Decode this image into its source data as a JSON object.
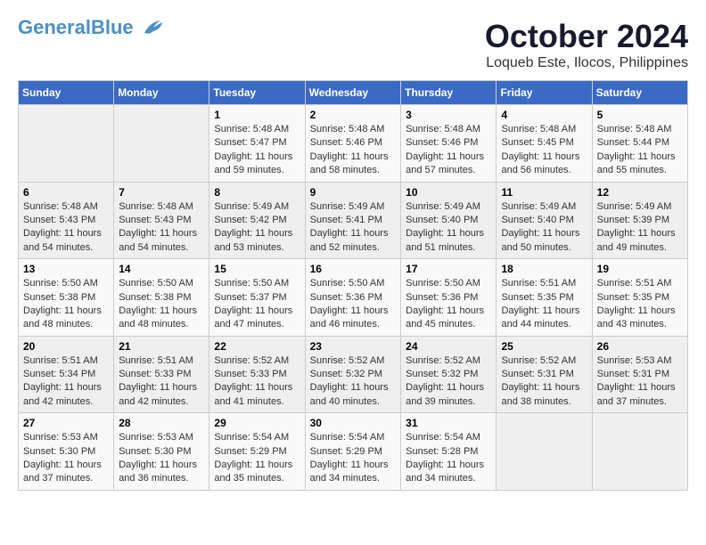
{
  "header": {
    "logo_line1": "General",
    "logo_line2": "Blue",
    "month_title": "October 2024",
    "subtitle": "Loqueb Este, Ilocos, Philippines"
  },
  "weekdays": [
    "Sunday",
    "Monday",
    "Tuesday",
    "Wednesday",
    "Thursday",
    "Friday",
    "Saturday"
  ],
  "weeks": [
    [
      {
        "day": "",
        "info": ""
      },
      {
        "day": "",
        "info": ""
      },
      {
        "day": "1",
        "info": "Sunrise: 5:48 AM\nSunset: 5:47 PM\nDaylight: 11 hours and 59 minutes."
      },
      {
        "day": "2",
        "info": "Sunrise: 5:48 AM\nSunset: 5:46 PM\nDaylight: 11 hours and 58 minutes."
      },
      {
        "day": "3",
        "info": "Sunrise: 5:48 AM\nSunset: 5:46 PM\nDaylight: 11 hours and 57 minutes."
      },
      {
        "day": "4",
        "info": "Sunrise: 5:48 AM\nSunset: 5:45 PM\nDaylight: 11 hours and 56 minutes."
      },
      {
        "day": "5",
        "info": "Sunrise: 5:48 AM\nSunset: 5:44 PM\nDaylight: 11 hours and 55 minutes."
      }
    ],
    [
      {
        "day": "6",
        "info": "Sunrise: 5:48 AM\nSunset: 5:43 PM\nDaylight: 11 hours and 54 minutes."
      },
      {
        "day": "7",
        "info": "Sunrise: 5:48 AM\nSunset: 5:43 PM\nDaylight: 11 hours and 54 minutes."
      },
      {
        "day": "8",
        "info": "Sunrise: 5:49 AM\nSunset: 5:42 PM\nDaylight: 11 hours and 53 minutes."
      },
      {
        "day": "9",
        "info": "Sunrise: 5:49 AM\nSunset: 5:41 PM\nDaylight: 11 hours and 52 minutes."
      },
      {
        "day": "10",
        "info": "Sunrise: 5:49 AM\nSunset: 5:40 PM\nDaylight: 11 hours and 51 minutes."
      },
      {
        "day": "11",
        "info": "Sunrise: 5:49 AM\nSunset: 5:40 PM\nDaylight: 11 hours and 50 minutes."
      },
      {
        "day": "12",
        "info": "Sunrise: 5:49 AM\nSunset: 5:39 PM\nDaylight: 11 hours and 49 minutes."
      }
    ],
    [
      {
        "day": "13",
        "info": "Sunrise: 5:50 AM\nSunset: 5:38 PM\nDaylight: 11 hours and 48 minutes."
      },
      {
        "day": "14",
        "info": "Sunrise: 5:50 AM\nSunset: 5:38 PM\nDaylight: 11 hours and 48 minutes."
      },
      {
        "day": "15",
        "info": "Sunrise: 5:50 AM\nSunset: 5:37 PM\nDaylight: 11 hours and 47 minutes."
      },
      {
        "day": "16",
        "info": "Sunrise: 5:50 AM\nSunset: 5:36 PM\nDaylight: 11 hours and 46 minutes."
      },
      {
        "day": "17",
        "info": "Sunrise: 5:50 AM\nSunset: 5:36 PM\nDaylight: 11 hours and 45 minutes."
      },
      {
        "day": "18",
        "info": "Sunrise: 5:51 AM\nSunset: 5:35 PM\nDaylight: 11 hours and 44 minutes."
      },
      {
        "day": "19",
        "info": "Sunrise: 5:51 AM\nSunset: 5:35 PM\nDaylight: 11 hours and 43 minutes."
      }
    ],
    [
      {
        "day": "20",
        "info": "Sunrise: 5:51 AM\nSunset: 5:34 PM\nDaylight: 11 hours and 42 minutes."
      },
      {
        "day": "21",
        "info": "Sunrise: 5:51 AM\nSunset: 5:33 PM\nDaylight: 11 hours and 42 minutes."
      },
      {
        "day": "22",
        "info": "Sunrise: 5:52 AM\nSunset: 5:33 PM\nDaylight: 11 hours and 41 minutes."
      },
      {
        "day": "23",
        "info": "Sunrise: 5:52 AM\nSunset: 5:32 PM\nDaylight: 11 hours and 40 minutes."
      },
      {
        "day": "24",
        "info": "Sunrise: 5:52 AM\nSunset: 5:32 PM\nDaylight: 11 hours and 39 minutes."
      },
      {
        "day": "25",
        "info": "Sunrise: 5:52 AM\nSunset: 5:31 PM\nDaylight: 11 hours and 38 minutes."
      },
      {
        "day": "26",
        "info": "Sunrise: 5:53 AM\nSunset: 5:31 PM\nDaylight: 11 hours and 37 minutes."
      }
    ],
    [
      {
        "day": "27",
        "info": "Sunrise: 5:53 AM\nSunset: 5:30 PM\nDaylight: 11 hours and 37 minutes."
      },
      {
        "day": "28",
        "info": "Sunrise: 5:53 AM\nSunset: 5:30 PM\nDaylight: 11 hours and 36 minutes."
      },
      {
        "day": "29",
        "info": "Sunrise: 5:54 AM\nSunset: 5:29 PM\nDaylight: 11 hours and 35 minutes."
      },
      {
        "day": "30",
        "info": "Sunrise: 5:54 AM\nSunset: 5:29 PM\nDaylight: 11 hours and 34 minutes."
      },
      {
        "day": "31",
        "info": "Sunrise: 5:54 AM\nSunset: 5:28 PM\nDaylight: 11 hours and 34 minutes."
      },
      {
        "day": "",
        "info": ""
      },
      {
        "day": "",
        "info": ""
      }
    ]
  ]
}
